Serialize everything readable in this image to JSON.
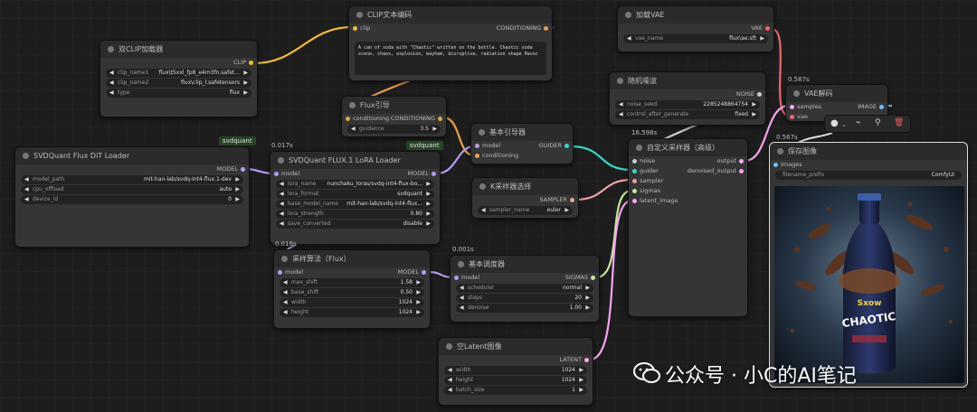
{
  "nodes": {
    "dual_clip": {
      "title": "双CLIP加载器",
      "out_clip": "CLIP",
      "clip_name1_label": "clip_name1",
      "clip_name1": "flux\\t5xxl_fp8_e4m3fn.safet...",
      "clip_name2_label": "clip_name2",
      "clip_name2": "flux\\clip_l.safetensors",
      "type_label": "type",
      "type": "flux"
    },
    "clip_text": {
      "title": "CLIP文本编码",
      "in_clip": "clip",
      "out_cond": "CONDITIONING",
      "text": "A can of soda with \"Chaotic\" written on the bottle. Chaotic soda scene, chaos, explosion, mayhem, disruptive, radiation shape Havoc"
    },
    "flux_guide": {
      "title": "Flux引导",
      "in_cond": "conditioning",
      "out_cond": "CONDITIONING",
      "guidance_label": "guidance",
      "guidance": "3.5"
    },
    "dit_loader": {
      "title": "SVDQuant Flux DiT Loader",
      "tag": "svdquant",
      "out_model": "MODEL",
      "model_path_label": "model_path",
      "model_path": "mit-han-lab/svdq-int4-flux.1-dev",
      "cpu_offload_label": "cpu_offload",
      "cpu_offload": "auto",
      "device_id_label": "device_id",
      "device_id": "0"
    },
    "lora_loader": {
      "title": "SVDQuant FLUX.1 LoRA Loader",
      "tag": "svdquant",
      "time": "0.017s",
      "in_model": "model",
      "out_model": "MODEL",
      "lora_name_label": "lora_name",
      "lora_name": "nunchaku_loras/svdq-int4-flux-bo...",
      "lora_format_label": "lora_format",
      "lora_format": "svdquant",
      "base_model_name_label": "base_model_name",
      "base_model_name": "mit-han-lab/svdq-int4-flux...",
      "lora_strength_label": "lora_strength",
      "lora_strength": "0.80",
      "save_converted_label": "save_converted",
      "save_converted": "disable"
    },
    "basic_guider": {
      "title": "基本引导器",
      "in_model": "model",
      "in_cond": "conditioning",
      "out_guider": "GUIDER"
    },
    "ksampler_select": {
      "title": "K采样器选择",
      "out_sampler": "SAMPLER",
      "sampler_name_label": "sampler_name",
      "sampler_name": "euler"
    },
    "sampling_flux": {
      "title": "采样算法（Flux）",
      "time": "0.016s",
      "in_model": "model",
      "out_model": "MODEL",
      "max_shift_label": "max_shift",
      "max_shift": "1.58",
      "base_shift_label": "base_shift",
      "base_shift": "0.50",
      "width_label": "width",
      "width": "1024",
      "height_label": "height",
      "height": "1024"
    },
    "basic_scheduler": {
      "title": "基本调度器",
      "time": "0.001s",
      "in_model": "model",
      "out_sigmas": "SIGMAS",
      "scheduler_label": "scheduler",
      "scheduler": "normal",
      "steps_label": "steps",
      "steps": "20",
      "denoise_label": "denoise",
      "denoise": "1.00"
    },
    "empty_latent": {
      "title": "空Latent图像",
      "out_latent": "LATENT",
      "width_label": "width",
      "width": "1024",
      "height_label": "height",
      "height": "1024",
      "batch_label": "batch_size",
      "batch": "1"
    },
    "vae_loader": {
      "title": "加载VAE",
      "out_vae": "VAE",
      "vae_name_label": "vae_name",
      "vae_name": "flux\\ae.sft"
    },
    "random_noise": {
      "title": "随机噪波",
      "out_noise": "NOISE",
      "noise_seed_label": "noise_seed",
      "noise_seed": "228524886475​4",
      "control_label": "control_after_generate",
      "control": "fixed"
    },
    "custom_sampler": {
      "title": "自定义采样器（高级）",
      "time": "16.598s",
      "in_noise": "noise",
      "in_guider": "guider",
      "in_sampler": "sampler",
      "in_sigmas": "sigmas",
      "in_latent": "latent_image",
      "out_output": "output",
      "out_denoised": "denoised_output"
    },
    "vae_decode": {
      "title": "VAE解码",
      "time": "0.587s",
      "in_samples": "samples",
      "in_vae": "vae",
      "out_image": "IMAGE"
    },
    "save_image": {
      "title": "保存图像",
      "time": "0.567s",
      "in_images": "images",
      "filename_prefix_label": "filename_prefix",
      "filename_prefix": "ComfyUI",
      "preview_text": "CHAOTIC",
      "preview_brand": "Sxow"
    }
  },
  "watermark": {
    "text": "公众号 · 小C的AI笔记"
  },
  "colors": {
    "clip": "#f5c02a",
    "conditioning": "#e8a24a",
    "model": "#b49cf0",
    "guider": "#36d9c9",
    "sampler": "#f0a0a8",
    "sigmas": "#c8e6a0",
    "latent": "#f7a6f2",
    "vae": "#f0666d",
    "noise": "#cccccc",
    "image": "#6cc0ff"
  }
}
